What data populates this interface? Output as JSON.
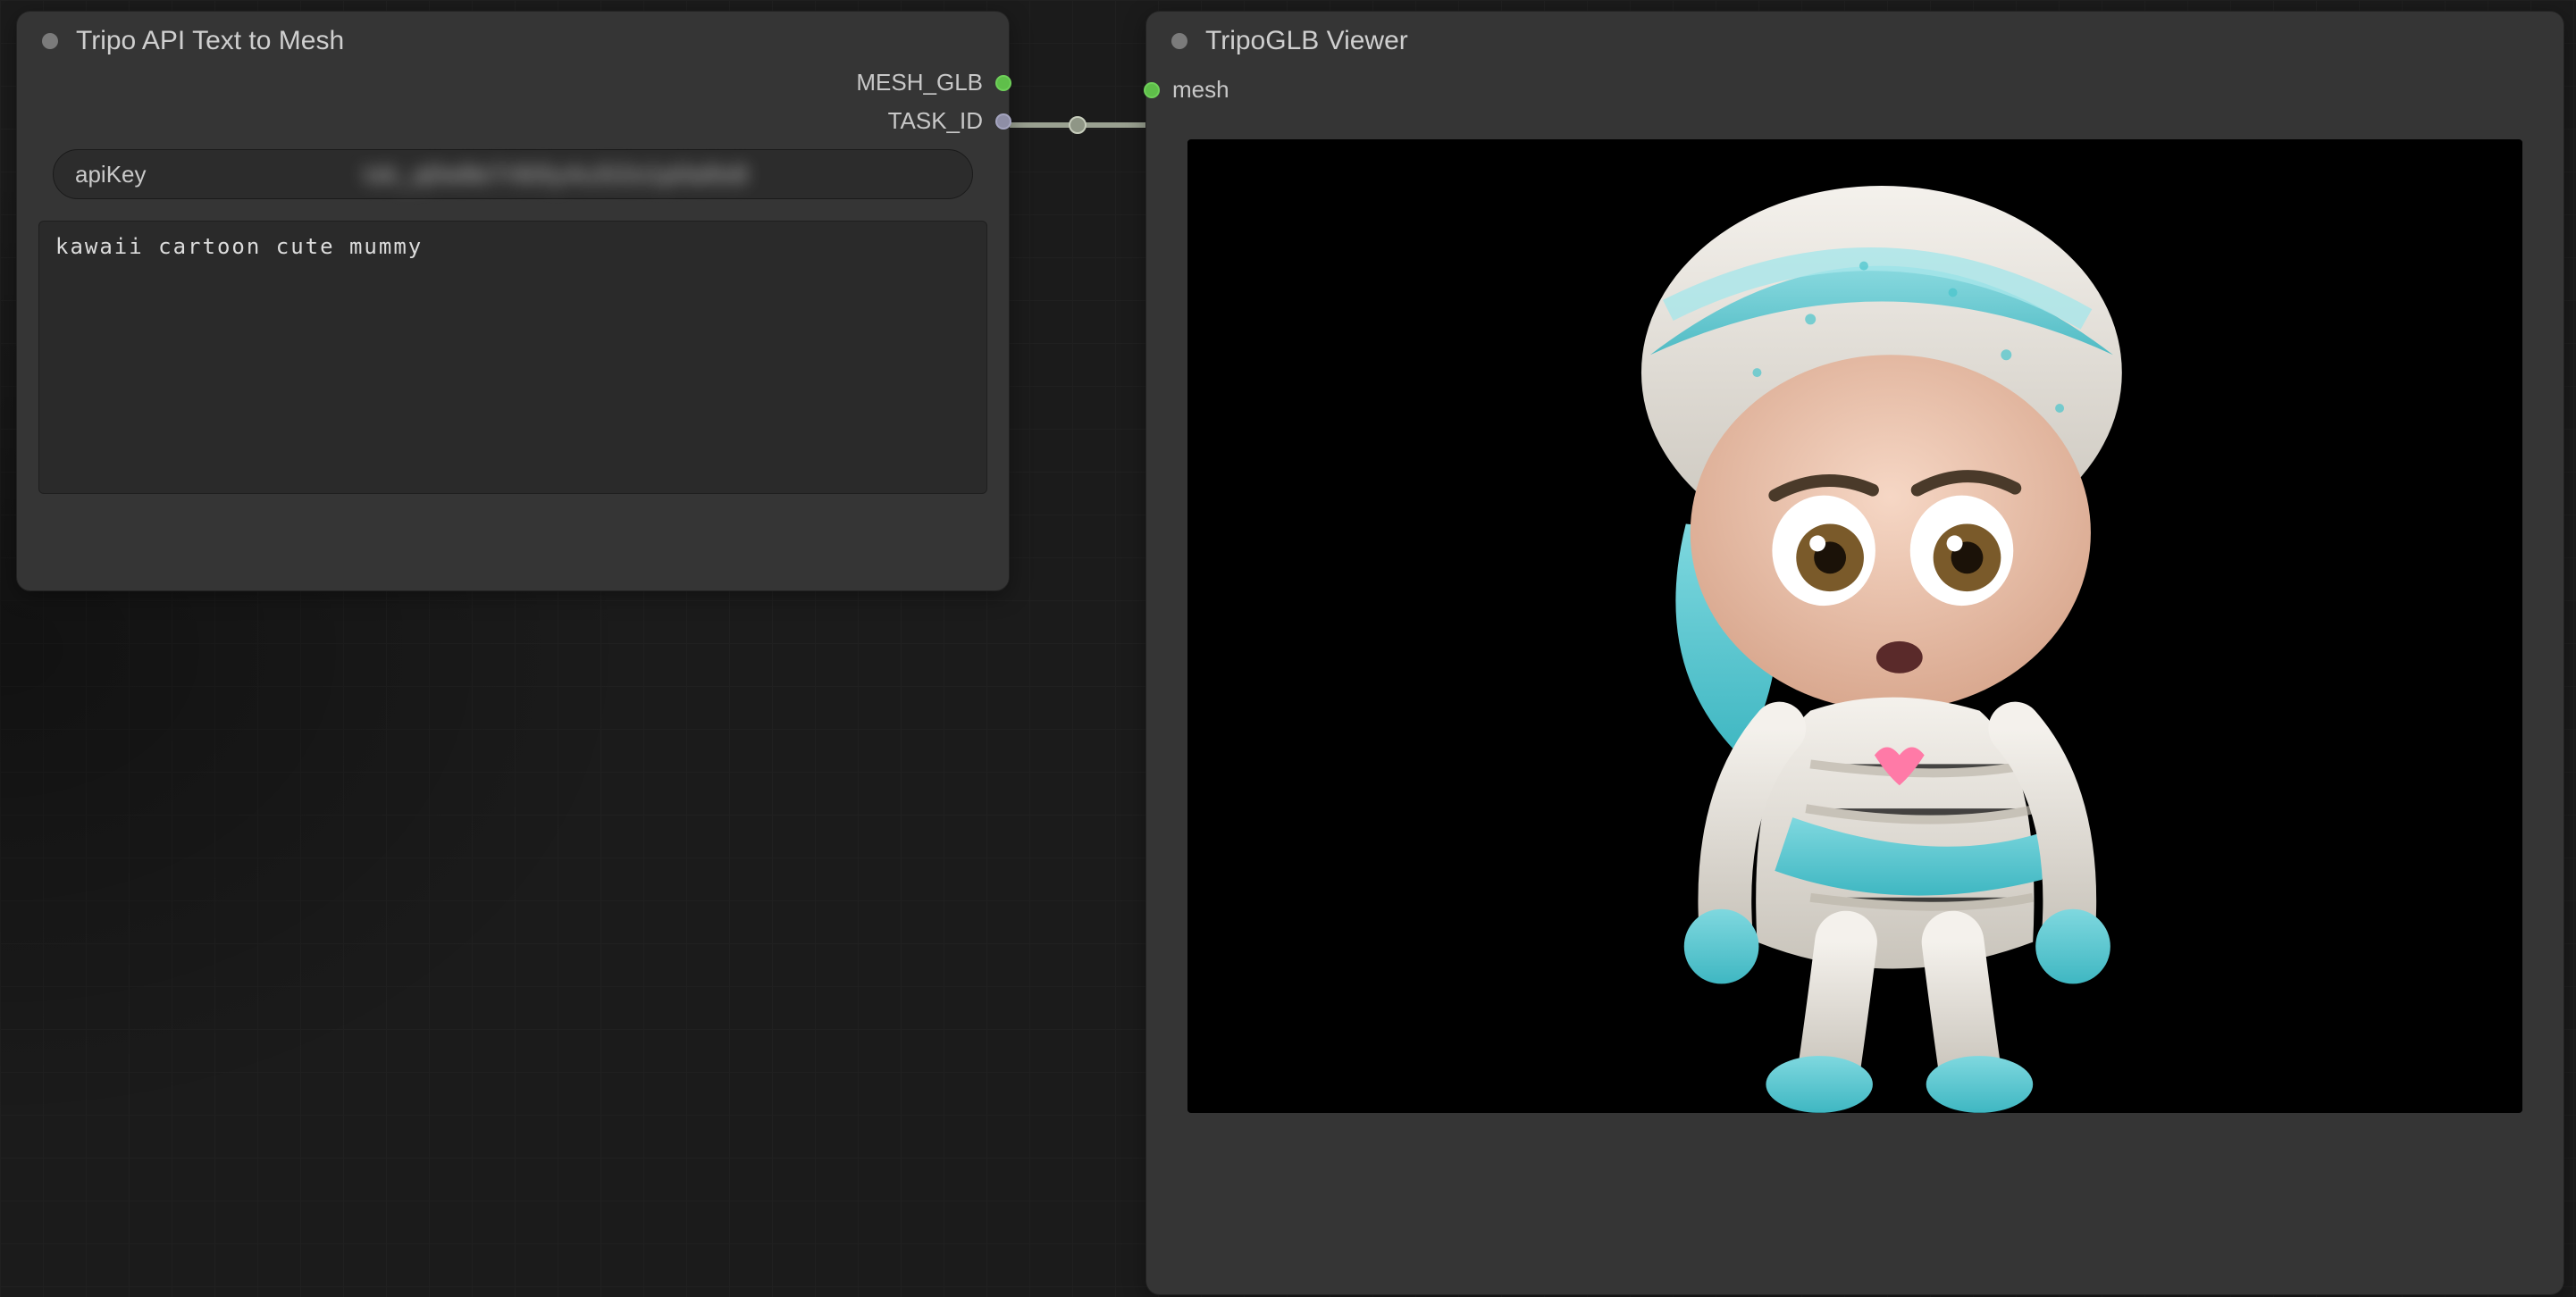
{
  "left_node": {
    "title": "Tripo API Text to Mesh",
    "outputs": [
      {
        "name": "MESH_GLB",
        "color": "green"
      },
      {
        "name": "TASK_ID",
        "color": "grey"
      }
    ],
    "apiKey": {
      "label": "apiKey",
      "value": "tsk_q0w8e7r6t5y4u3i2o1p0a9s8"
    },
    "prompt": "kawaii cartoon cute mummy"
  },
  "right_node": {
    "title": "TripoGLB Viewer",
    "inputs": [
      {
        "name": "mesh",
        "color": "green"
      }
    ]
  }
}
